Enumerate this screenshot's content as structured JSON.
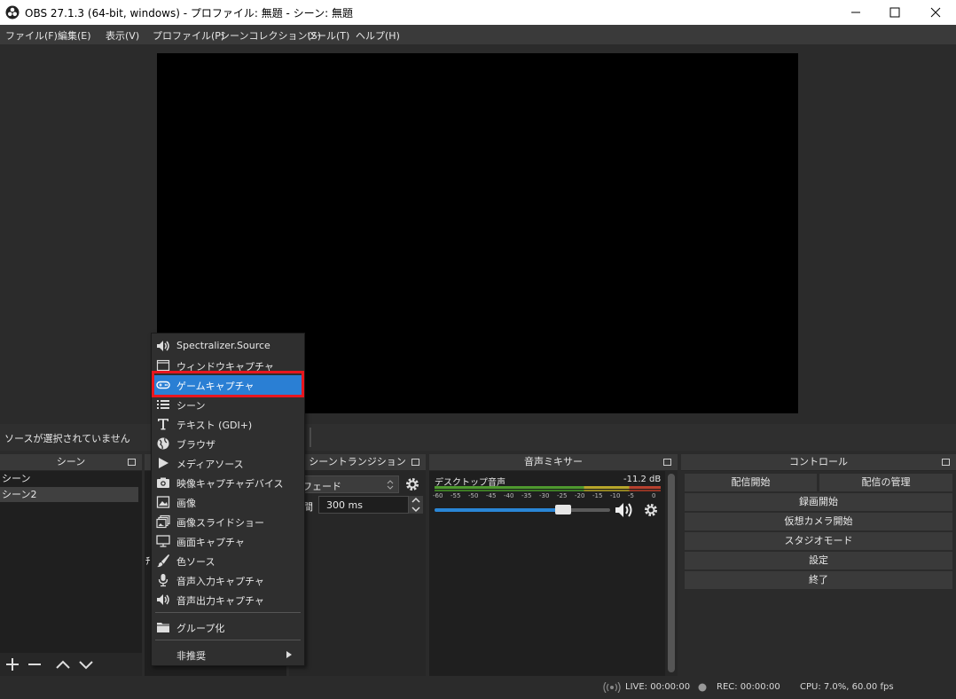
{
  "window": {
    "title": "OBS 27.1.3 (64-bit, windows) - プロファイル: 無題 - シーン: 無題"
  },
  "menu": [
    "ファイル(F)",
    "編集(E)",
    "表示(V)",
    "プロファイル(P)",
    "シーンコレクション(S)",
    "ツール(T)",
    "ヘルプ(H)"
  ],
  "status_strip": {
    "text": "ソースが選択されていません"
  },
  "scenes": {
    "title": "シーン",
    "items": [
      "シーン",
      "シーン2"
    ],
    "selected": "シーン2"
  },
  "transitions": {
    "title": "シーントランジション",
    "type": "フェード",
    "duration_label": "間",
    "duration_value": "300 ms"
  },
  "mixer": {
    "title": "音声ミキサー",
    "track_name": "デスクトップ音声",
    "level": "-11.2 dB",
    "scale": [
      "-60",
      "-55",
      "-50",
      "-45",
      "-40",
      "-35",
      "-30",
      "-25",
      "-20",
      "-15",
      "-10",
      "-5",
      "0"
    ],
    "volume_fraction": 0.73
  },
  "controls": {
    "title": "コントロール",
    "start_streaming": "配信開始",
    "manage_broadcast": "配信の管理",
    "start_recording": "録画開始",
    "start_virtual_cam": "仮想カメラ開始",
    "studio_mode": "スタジオモード",
    "settings": "設定",
    "exit": "終了"
  },
  "bottom_status": {
    "live": "LIVE: 00:00:00",
    "rec": "REC: 00:00:00",
    "cpu": "CPU: 7.0%, 60.00 fps"
  },
  "sources_partial_label": "ﾁ",
  "context_menu": {
    "items": [
      {
        "label": "Spectralizer.Source",
        "icon": "speaker-icon"
      },
      {
        "label": "ウィンドウキャプチャ",
        "icon": "window-icon"
      },
      {
        "label": "ゲームキャプチャ",
        "icon": "gamepad-icon",
        "highlighted": true
      },
      {
        "label": "シーン",
        "icon": "list-icon"
      },
      {
        "label": "テキスト (GDI+)",
        "icon": "text-icon"
      },
      {
        "label": "ブラウザ",
        "icon": "globe-icon"
      },
      {
        "label": "メディアソース",
        "icon": "play-icon"
      },
      {
        "label": "映像キャプチャデバイス",
        "icon": "camera-icon"
      },
      {
        "label": "画像",
        "icon": "image-icon"
      },
      {
        "label": "画像スライドショー",
        "icon": "slideshow-icon"
      },
      {
        "label": "画面キャプチャ",
        "icon": "monitor-icon"
      },
      {
        "label": "色ソース",
        "icon": "brush-icon"
      },
      {
        "label": "音声入力キャプチャ",
        "icon": "microphone-icon"
      },
      {
        "label": "音声出力キャプチャ",
        "icon": "speaker-icon"
      }
    ],
    "group_label": "グループ化",
    "deprecated_label": "非推奨"
  },
  "colors": {
    "highlight": "#2a7fd4",
    "highlight_border": "#e8161e",
    "preview_bg": "#000000"
  }
}
